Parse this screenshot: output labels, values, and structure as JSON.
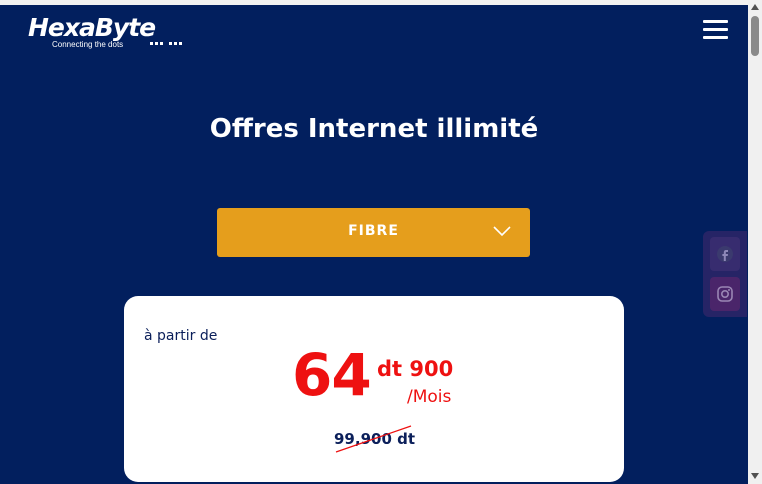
{
  "header": {
    "logo_text": "HexaByte",
    "logo_tagline": "Connecting the dots",
    "menu_icon": "hamburger-menu-icon"
  },
  "main": {
    "title": "Offres Internet illimité",
    "offer_select": {
      "selected": "FIBRE",
      "icon": "chevron-down-icon"
    }
  },
  "offer_card": {
    "from_label": "à partir de",
    "price_integer": "64",
    "price_decimal": "dt 900",
    "price_period": "/Mois",
    "old_price": "99,900 dt"
  },
  "social": {
    "items": [
      {
        "icon": "facebook-icon"
      },
      {
        "icon": "instagram-icon"
      }
    ]
  },
  "colors": {
    "background": "#021f5e",
    "accent": "#e59e1c",
    "price": "#ee1111",
    "text_dark": "#0b1f5a"
  }
}
